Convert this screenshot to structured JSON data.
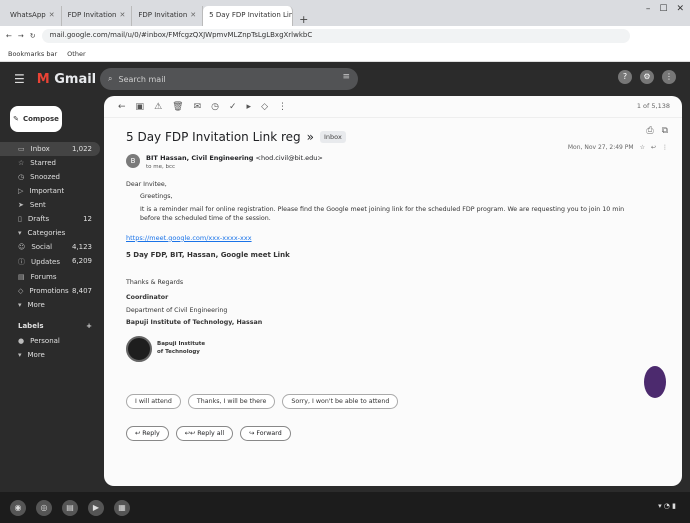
{
  "browser": {
    "tabs": [
      {
        "label": "WhatsApp"
      },
      {
        "label": "FDP Invitation"
      },
      {
        "label": "FDP Invitation"
      },
      {
        "label": "5 Day FDP Invitation Link reg..."
      }
    ],
    "url": "mail.google.com/mail/u/0/#inbox/FMfcgzQXJWpmvMLZnpTsLgLBxgXrlwkbC",
    "bookmarks": [
      "Bookmarks bar",
      "Other"
    ]
  },
  "gmail": {
    "logo": "Gmail",
    "search_placeholder": "Search mail",
    "compose": "Compose",
    "nav": [
      {
        "label": "Inbox",
        "count": "1,022",
        "icon": "inbox-icon"
      },
      {
        "label": "Starred",
        "count": "",
        "icon": "star-icon"
      },
      {
        "label": "Snoozed",
        "count": "",
        "icon": "clock-icon"
      },
      {
        "label": "Important",
        "count": "",
        "icon": "label-icon"
      },
      {
        "label": "Sent",
        "count": "",
        "icon": "send-icon"
      },
      {
        "label": "Drafts",
        "count": "12",
        "icon": "draft-icon"
      },
      {
        "label": "Categories",
        "count": "",
        "icon": "chevron-icon"
      },
      {
        "label": "Social",
        "count": "4,123",
        "icon": "people-icon"
      },
      {
        "label": "Updates",
        "count": "6,209",
        "icon": "info-icon"
      },
      {
        "label": "Forums",
        "count": "",
        "icon": "forum-icon"
      },
      {
        "label": "Promotions",
        "count": "8,407",
        "icon": "tag-icon"
      },
      {
        "label": "More",
        "count": "",
        "icon": "more-icon"
      }
    ],
    "labels_heading": "Labels",
    "labels": [
      {
        "label": "Personal"
      },
      {
        "label": "More"
      }
    ],
    "pager": "1 of 5,138",
    "subject": "5 Day FDP Invitation Link reg",
    "subject_badge": "Inbox",
    "sender_name": "BIT Hassan, Civil Engineering",
    "sender_email": "<hod.civil@bit.edu>",
    "to_line": "to me, bcc",
    "date": "Mon, Nov 27, 2:49 PM",
    "greeting": "Dear Invitee,",
    "para1": "Greetings,",
    "para2": "It is a reminder mail for online registration. Please find the Google meet joining link for the scheduled FDP program. We are requesting you to join 10 min before the scheduled time of the session.",
    "link": "https://meet.google.com/xxx-xxxx-xxx",
    "bold_line": "5 Day FDP, BIT, Hassan, Google meet Link",
    "closing": "Thanks & Regards",
    "sig_name": "Coordinator",
    "sig_dept": "Department of Civil Engineering",
    "sig_inst": "Bapuji Institute of Technology, Hassan",
    "seal_text1": "Bapuji Institute",
    "seal_text2": "of Technology",
    "smart_replies": [
      "I will attend",
      "Thanks, I will be there",
      "Sorry, I won't be able to attend"
    ],
    "actions": [
      "Reply",
      "Reply all",
      "Forward"
    ]
  }
}
